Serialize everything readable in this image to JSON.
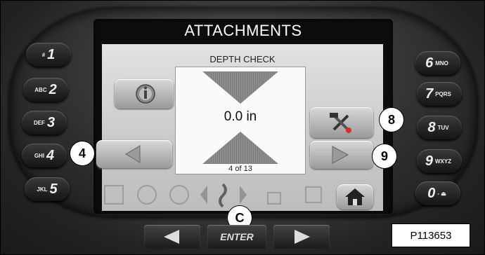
{
  "screen": {
    "title": "ATTACHMENTS",
    "subtitle": "DEPTH CHECK",
    "readout": "0.0 in",
    "page_count": "4 of 13"
  },
  "left_keys": [
    {
      "letters": "#",
      "number": "1"
    },
    {
      "letters": "ABC",
      "number": "2"
    },
    {
      "letters": "DEF",
      "number": "3"
    },
    {
      "letters": "GHI",
      "number": "4"
    },
    {
      "letters": "JKL",
      "number": "5"
    }
  ],
  "right_keys": [
    {
      "number": "6",
      "letters": "MNO"
    },
    {
      "number": "7",
      "letters": "PQRS"
    },
    {
      "number": "8",
      "letters": "TUV"
    },
    {
      "number": "9",
      "letters": "WXYZ"
    },
    {
      "number": "0",
      "letters": "- ⏏"
    }
  ],
  "callouts": {
    "c4": "4",
    "c8": "8",
    "c9": "9",
    "cC": "C"
  },
  "enter_label": "ENTER",
  "figure_id": "P113653",
  "icons": [
    "info-icon",
    "tools-icon",
    "left-arrow-icon",
    "right-arrow-icon",
    "home-icon"
  ]
}
